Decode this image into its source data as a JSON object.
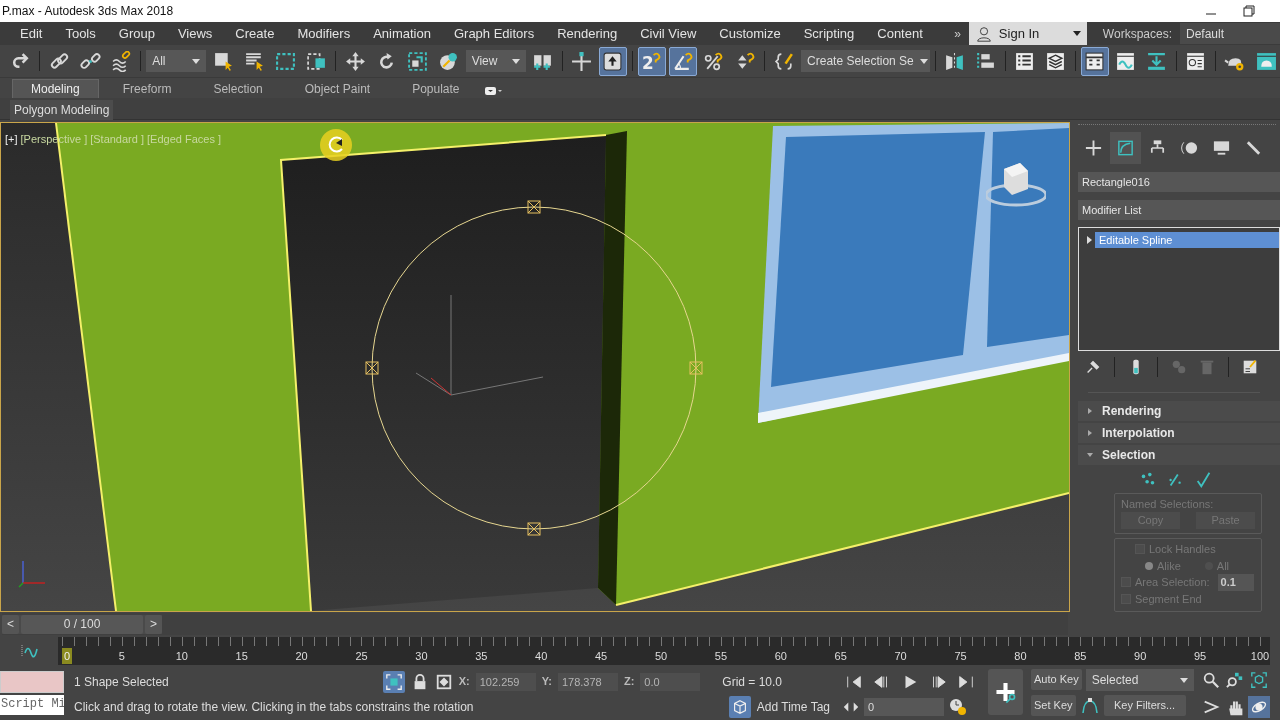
{
  "window": {
    "title": "P.max - Autodesk 3ds Max 2018"
  },
  "menu": [
    "Edit",
    "Tools",
    "Group",
    "Views",
    "Create",
    "Modifiers",
    "Animation",
    "Graph Editors",
    "Rendering",
    "Civil View",
    "Customize",
    "Scripting",
    "Content"
  ],
  "menu_overflow": "»",
  "account": {
    "label": "Sign In"
  },
  "workspaces": {
    "label": "Workspaces:",
    "value": "Default"
  },
  "toolbar": [
    {
      "kind": "icon",
      "selected": false
    },
    {
      "kind": "separator"
    },
    {
      "kind": "icon",
      "selected": false
    },
    {
      "kind": "icon",
      "selected": false
    },
    {
      "kind": "icon",
      "selected": false
    },
    {
      "kind": "separator"
    },
    {
      "kind": "dropdown",
      "value": "All"
    },
    {
      "kind": "icon",
      "selected": false
    },
    {
      "kind": "icon",
      "selected": false
    },
    {
      "kind": "icon",
      "selected": false
    },
    {
      "kind": "icon",
      "selected": false
    },
    {
      "kind": "separator"
    },
    {
      "kind": "icon",
      "selected": false
    },
    {
      "kind": "icon",
      "selected": false
    },
    {
      "kind": "icon",
      "selected": false
    },
    {
      "kind": "icon",
      "selected": false
    },
    {
      "kind": "dropdown",
      "value": "View"
    },
    {
      "kind": "icon",
      "selected": false
    },
    {
      "kind": "separator"
    },
    {
      "kind": "icon",
      "selected": false
    },
    {
      "kind": "icon",
      "selected": true
    },
    {
      "kind": "separator"
    },
    {
      "kind": "icon",
      "selected": true,
      "glyph": "2"
    },
    {
      "kind": "icon",
      "selected": true
    },
    {
      "kind": "icon",
      "selected": false
    },
    {
      "kind": "icon",
      "selected": false
    },
    {
      "kind": "separator"
    },
    {
      "kind": "icon",
      "selected": false
    },
    {
      "kind": "dropdown",
      "value": "Create Selection Se"
    },
    {
      "kind": "separator"
    },
    {
      "kind": "icon",
      "selected": false
    },
    {
      "kind": "icon",
      "selected": false
    },
    {
      "kind": "separator"
    },
    {
      "kind": "icon",
      "selected": false
    },
    {
      "kind": "icon",
      "selected": false
    },
    {
      "kind": "separator"
    },
    {
      "kind": "icon",
      "selected": true
    },
    {
      "kind": "icon",
      "selected": false
    },
    {
      "kind": "icon",
      "selected": false
    },
    {
      "kind": "separator"
    },
    {
      "kind": "icon",
      "selected": false
    },
    {
      "kind": "separator"
    },
    {
      "kind": "icon",
      "selected": false
    },
    {
      "kind": "icon",
      "selected": false
    }
  ],
  "ribbon": {
    "tabs": [
      {
        "label": "Modeling",
        "selected": true
      },
      {
        "label": "Freeform",
        "selected": false
      },
      {
        "label": "Selection",
        "selected": false
      },
      {
        "label": "Object Paint",
        "selected": false
      },
      {
        "label": "Populate",
        "selected": false
      }
    ],
    "panel": "Polygon Modeling"
  },
  "viewport": {
    "labels": [
      "[+]",
      "[Perspective ]",
      "[Standard ]",
      "[Edged Faces ]"
    ]
  },
  "command_panel": {
    "tabs": [
      {
        "selected": false
      },
      {
        "selected": true
      },
      {
        "selected": false
      },
      {
        "selected": false
      },
      {
        "selected": false
      },
      {
        "selected": false
      }
    ],
    "object_name": "Rectangle016",
    "modifier_list": "Modifier List",
    "stack": [
      {
        "label": "Editable Spline",
        "selected": true,
        "expanded": false
      }
    ],
    "rollouts": [
      {
        "title": "Rendering",
        "expanded": false
      },
      {
        "title": "Interpolation",
        "expanded": false
      },
      {
        "title": "Selection",
        "expanded": true
      }
    ],
    "selection": {
      "disabled": true,
      "named_selections": "Named Selections:",
      "buttons": [
        "Copy",
        "Paste"
      ],
      "lock_handles": {
        "label": "Lock Handles",
        "checked": false
      },
      "radios": [
        {
          "label": "Alike",
          "selected": true
        },
        {
          "label": "All",
          "selected": false
        }
      ],
      "area_selection": {
        "label": "Area Selection:",
        "checked": false,
        "value": "0.1"
      },
      "segment_end": {
        "label": "Segment End",
        "checked": false
      }
    }
  },
  "time_slider": {
    "prev": "<",
    "label": "0 / 100",
    "next": ">",
    "level": 0
  },
  "track_bar": {
    "ticks": [
      "0",
      "5",
      "10",
      "15",
      "20",
      "25",
      "30",
      "35",
      "40",
      "45",
      "50",
      "55",
      "60",
      "65",
      "70",
      "75",
      "80",
      "85",
      "90",
      "95",
      "100"
    ]
  },
  "status": {
    "script_listener": "Script Mi",
    "selection": "1 Shape Selected",
    "prompt": "Click and drag to rotate the view.  Clicking in the tabs constrains the rotation",
    "coords": [
      {
        "label": "X:",
        "value": "102.259"
      },
      {
        "label": "Y:",
        "value": "178.378"
      },
      {
        "label": "Z:",
        "value": "0.0"
      }
    ],
    "grid": "Grid = 10.0",
    "time_tag": "Add Time Tag",
    "frame": "0",
    "auto_key": "Auto Key",
    "key_mode": "Selected",
    "set_key": "Set Key",
    "key_filters": "Key Filters...",
    "navigation": [
      {
        "selected": false
      },
      {
        "selected": false
      },
      {
        "selected": false
      },
      {
        "selected": false
      },
      {
        "selected": false
      },
      {
        "selected": true
      }
    ]
  }
}
